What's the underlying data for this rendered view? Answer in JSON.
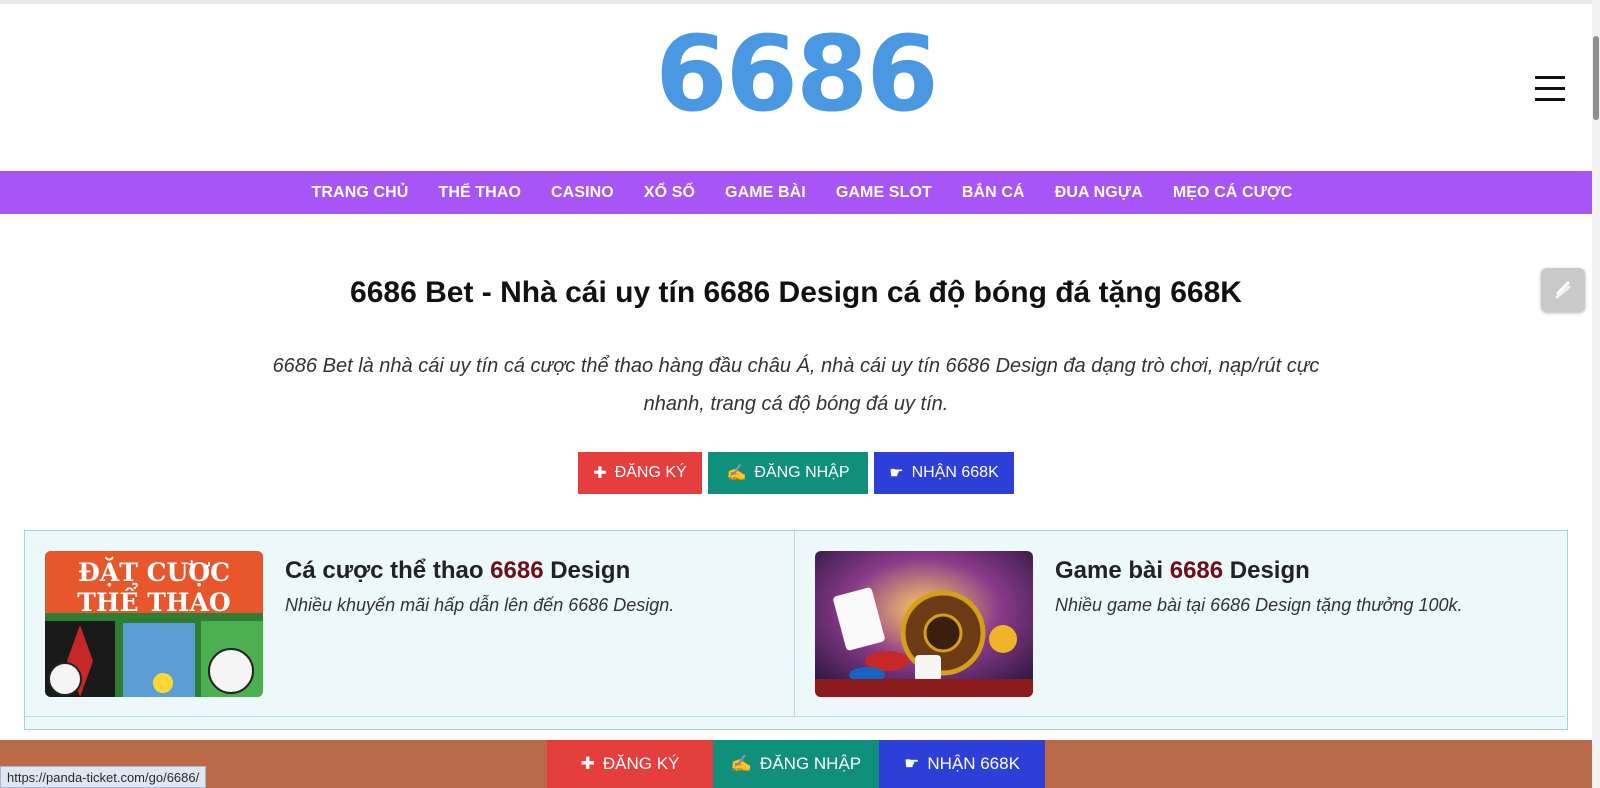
{
  "header": {
    "logo_text": "6686"
  },
  "nav": {
    "items": [
      "TRANG CHỦ",
      "THỂ THAO",
      "CASINO",
      "XỔ SỐ",
      "GAME BÀI",
      "GAME SLOT",
      "BẮN CÁ",
      "ĐUA NGỰA",
      "MẸO CÁ CƯỢC"
    ]
  },
  "hero": {
    "title": "6686 Bet - Nhà cái uy tín 6686 Design cá độ bóng đá tặng 668K",
    "description": "6686 Bet là nhà cái uy tín cá cược thể thao hàng đầu châu Á, nhà cái uy tín 6686 Design đa dạng trò chơi, nạp/rút cực nhanh, trang cá độ bóng đá uy tín."
  },
  "buttons": {
    "register": {
      "icon": "✚",
      "label": "ĐĂNG KÝ"
    },
    "login": {
      "icon": "✍",
      "label": "ĐĂNG NHẬP"
    },
    "bonus": {
      "icon": "☛",
      "label": "NHẬN 668K"
    }
  },
  "cards": [
    {
      "image_text_1": "ĐẶT CƯỢC",
      "image_text_2": "THỂ THAO",
      "title_prefix": "Cá cược thể thao ",
      "title_brand": "6686",
      "title_suffix": " Design",
      "desc": "Nhiều khuyến mãi hấp dẫn lên đến 6686 Design."
    },
    {
      "title_prefix": "Game bài ",
      "title_brand": "6686",
      "title_suffix": " Design",
      "desc": "Nhiều game bài tại 6686 Design tặng thưởng 100k."
    }
  ],
  "status_bar": {
    "url": "https://panda-ticket.com/go/6686/"
  },
  "colors": {
    "logo": "#4a97e2",
    "nav": "#a855f7",
    "register": "#e53e3e",
    "login": "#0f8f7c",
    "bonus": "#2d3fd6",
    "bottom_bar": "#b86a49"
  }
}
